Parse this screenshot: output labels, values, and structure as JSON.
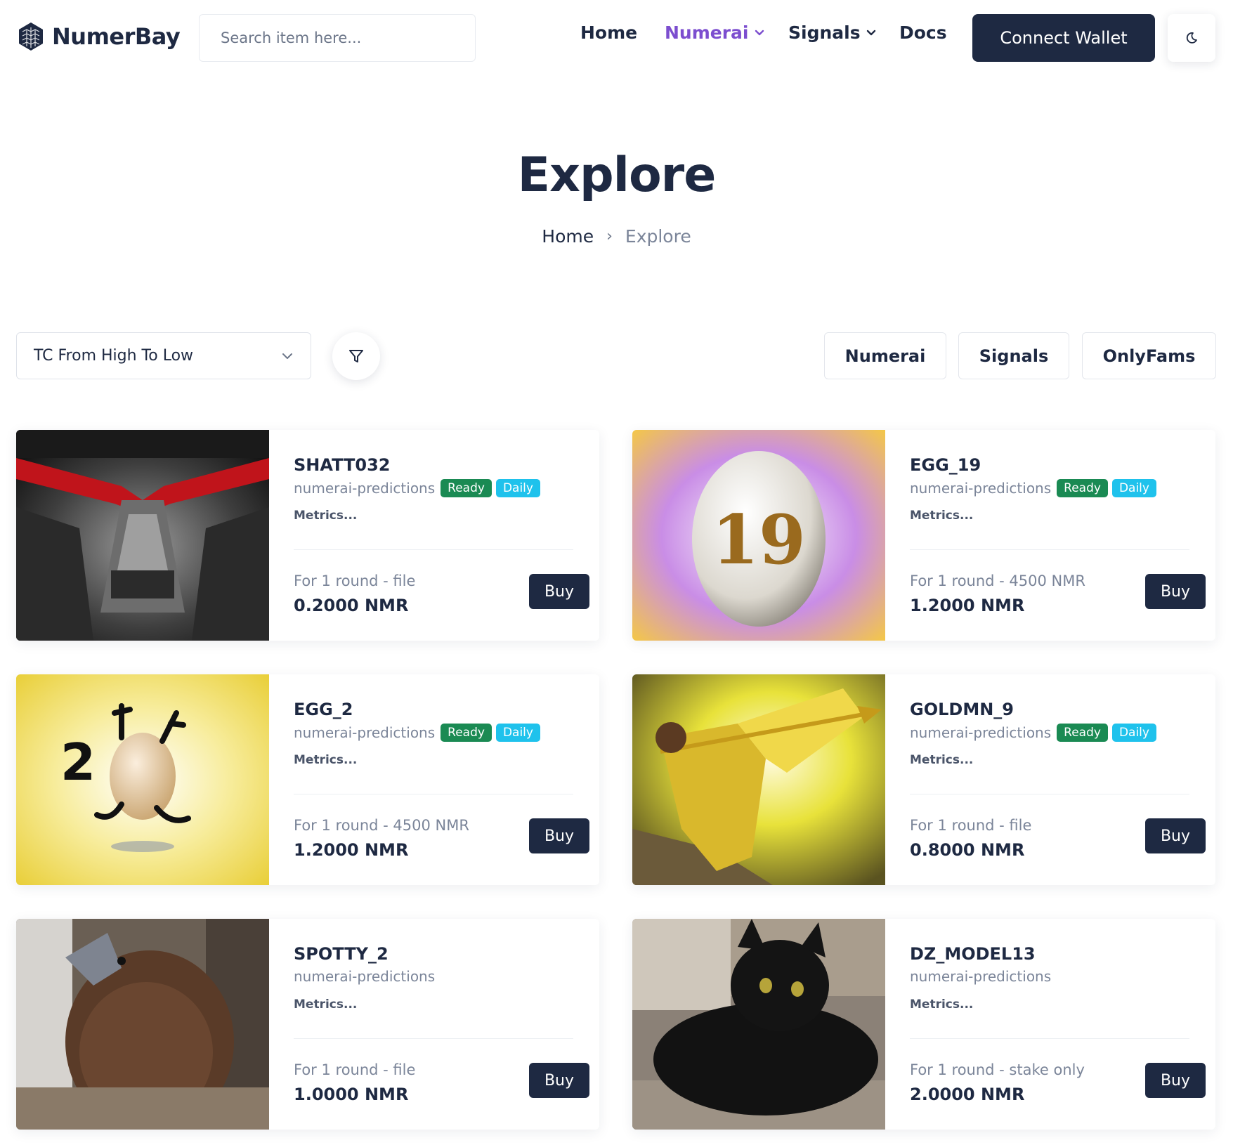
{
  "header": {
    "logo_text": "NumerBay",
    "search_placeholder": "Search item here...",
    "nav": {
      "home": "Home",
      "numerai": "Numerai",
      "signals": "Signals",
      "docs": "Docs"
    },
    "connect_wallet": "Connect Wallet",
    "theme_icon": "moon-icon"
  },
  "page": {
    "title": "Explore",
    "breadcrumb": {
      "home": "Home",
      "separator": "›",
      "current": "Explore"
    }
  },
  "toolbar": {
    "sort_value": "TC From High To Low",
    "categories": [
      "Numerai",
      "Signals",
      "OnlyFams"
    ]
  },
  "products": [
    {
      "name": "SHATT032",
      "category": "numerai-predictions",
      "badges": [
        "Ready",
        "Daily"
      ],
      "metrics": "Metrics...",
      "plan": "For 1 round - file",
      "price": "0.2000 NMR",
      "buy": "Buy"
    },
    {
      "name": "EGG_19",
      "category": "numerai-predictions",
      "badges": [
        "Ready",
        "Daily"
      ],
      "metrics": "Metrics...",
      "plan": "For 1 round - 4500 NMR",
      "price": "1.2000 NMR",
      "buy": "Buy"
    },
    {
      "name": "EGG_2",
      "category": "numerai-predictions",
      "badges": [
        "Ready",
        "Daily"
      ],
      "metrics": "Metrics...",
      "plan": "For 1 round - 4500 NMR",
      "price": "1.2000 NMR",
      "buy": "Buy"
    },
    {
      "name": "GOLDMN_9",
      "category": "numerai-predictions",
      "badges": [
        "Ready",
        "Daily"
      ],
      "metrics": "Metrics...",
      "plan": "For 1 round - file",
      "price": "0.8000 NMR",
      "buy": "Buy"
    },
    {
      "name": "SPOTTY_2",
      "category": "numerai-predictions",
      "badges": [],
      "metrics": "Metrics...",
      "plan": "For 1 round - file",
      "price": "1.0000 NMR",
      "buy": "Buy"
    },
    {
      "name": "DZ_MODEL13",
      "category": "numerai-predictions",
      "badges": [],
      "metrics": "Metrics...",
      "plan": "For 1 round - stake only",
      "price": "2.0000 NMR",
      "buy": "Buy"
    }
  ],
  "colors": {
    "primary": "#1e2942",
    "accent_purple": "#7c4ecf",
    "ready_green": "#1a8a53",
    "daily_cyan": "#1fc2ec",
    "muted_text": "#7b8599"
  }
}
